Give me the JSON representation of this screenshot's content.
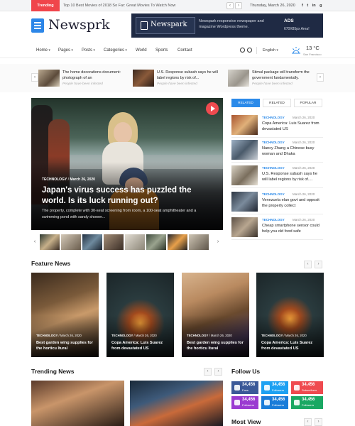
{
  "topbar": {
    "trending_label": "Trending",
    "ticker_text": "Top 10 Best Movies of 2018 So Far: Great Movies To Watch Now",
    "prev_symbol": "‹",
    "next_symbol": "›",
    "date": "Thursday, March 26, 2020",
    "social": [
      "f",
      "t",
      "in",
      "g"
    ]
  },
  "header": {
    "logo_text": "Newsprk",
    "banner": {
      "logo_text": "Newspark",
      "description": "Newspark responsive newspaper and magazine Wordpress theme.",
      "ads_label": "ADS",
      "ads_size": "670X85px Area!"
    }
  },
  "nav": {
    "items": [
      "Home",
      "Pages",
      "Posts",
      "Categories",
      "World",
      "Sports",
      "Contact"
    ],
    "language": "English",
    "temperature": "13 °C",
    "location": "San Francisco"
  },
  "headline_strip": {
    "items": [
      {
        "title": "The home decorations document: photograph of an",
        "meta": "People have been infected"
      },
      {
        "title": "U.S. Response subash says he will label regions by risk of...",
        "meta": "People have been infected"
      },
      {
        "title": "Stimul package will transform the government fundamentally.",
        "meta": "People have been infected"
      }
    ]
  },
  "hero": {
    "category": "TECHNOLOGY",
    "date": "March 26, 2020",
    "title": "Japan's virus success has puzzled the world. Is its luck running out?",
    "description": "The property, complete with 30-seat screening from room, a 100-seat amphitheater and a swimming pond with sandy shower..."
  },
  "tabs": [
    "RELATED",
    "RELATED",
    "POPULAR"
  ],
  "side_list": [
    {
      "category": "TECHNOLOGY",
      "date": "March 26, 2020",
      "title": "Copa America: Luis Suarez from devastated US"
    },
    {
      "category": "TECHNOLOGY",
      "date": "March 26, 2020",
      "title": "Nancy Zhang a Chinese busy woman and Dhaka"
    },
    {
      "category": "TECHNOLOGY",
      "date": "March 26, 2020",
      "title": "U.S. Response subash says he will label regions by risk of...."
    },
    {
      "category": "TECHNOLOGY",
      "date": "March 26, 2020",
      "title": "Venezuela elan govt and opposit the property collect"
    },
    {
      "category": "TECHNOLOGY",
      "date": "March 26, 2020",
      "title": "Cheap smartphone sensor could help you old food safe"
    }
  ],
  "feature": {
    "title": "Feature News",
    "cards": [
      {
        "category": "TECHNOLOGY",
        "date": "March 26, 2020",
        "title": "Best garden wing supplies for the horticu ltural"
      },
      {
        "category": "TECHNOLOGY",
        "date": "March 26, 2020",
        "title": "Copa America: Luis Suarez from devastated US"
      },
      {
        "category": "TECHNOLOGY",
        "date": "March 26, 2020",
        "title": "Best garden wing supplies for the horticu ltural"
      },
      {
        "category": "TECHNOLOGY",
        "date": "March 26, 2020",
        "title": "Copa America: Luis Suarez from devastated US"
      }
    ]
  },
  "trending": {
    "title": "Trending News"
  },
  "follow": {
    "title": "Follow Us",
    "items": [
      {
        "count": "34,456",
        "label": "Fans",
        "color": "#3b5998",
        "icon": "facebook-icon"
      },
      {
        "count": "34,456",
        "label": "Followers",
        "color": "#1da1f2",
        "icon": "twitter-icon"
      },
      {
        "count": "34,456",
        "label": "Subscribers",
        "color": "#ef4a4f",
        "icon": "youtube-icon"
      },
      {
        "count": "34,456",
        "label": "Followers",
        "color": "#9b3bd1",
        "icon": "instagram-icon"
      },
      {
        "count": "34,456",
        "label": "Followers",
        "color": "#1a7cd9",
        "icon": "vimeo-icon"
      },
      {
        "count": "34,456",
        "label": "Followers",
        "color": "#1aa863",
        "icon": "google-icon"
      }
    ]
  },
  "most_view": {
    "title": "Most View"
  },
  "colors": {
    "accent": "#2b8ae9",
    "trending_red": "#f0454b",
    "banner_bg": "#1f2a44"
  }
}
